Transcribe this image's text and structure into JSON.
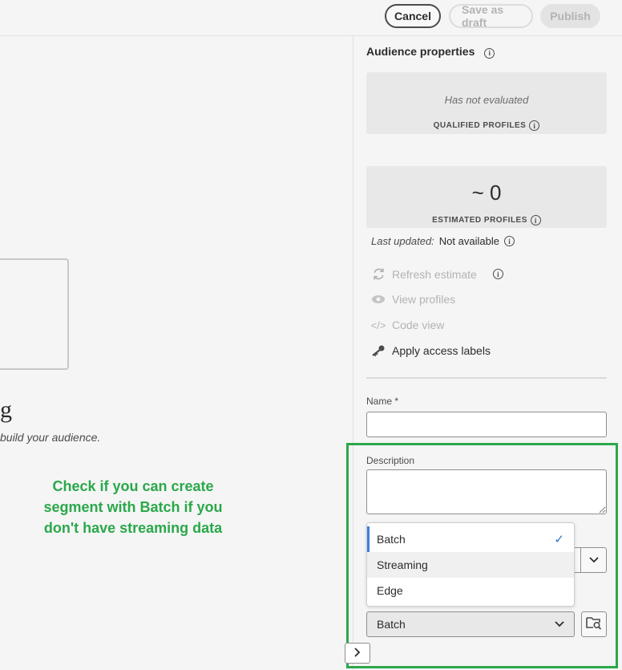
{
  "toolbar": {
    "cancel_label": "Cancel",
    "save_draft_label": "Save as draft",
    "publish_label": "Publish"
  },
  "canvas": {
    "heading_fragment": "g",
    "hint_text": "build your audience."
  },
  "annotation": {
    "text_line1": "Check if you can create",
    "text_line2": "segment with Batch if you",
    "text_line3": "don't have streaming data",
    "color": "#2aa84a"
  },
  "properties": {
    "title": "Audience properties",
    "qualified": {
      "status": "Has not evaluated",
      "label": "QUALIFIED PROFILES"
    },
    "estimated": {
      "value": "~ 0",
      "label": "ESTIMATED PROFILES"
    },
    "last_updated": {
      "label": "Last updated:",
      "value": "Not available"
    },
    "actions": {
      "refresh": "Refresh estimate",
      "view_profiles": "View profiles",
      "code_view": "Code view",
      "apply_labels": "Apply access labels"
    }
  },
  "form": {
    "name_label": "Name",
    "required_mark": "*",
    "name_value": "",
    "description_label": "Description",
    "description_value": ""
  },
  "evaluation_menu": {
    "options": [
      "Batch",
      "Streaming",
      "Edge"
    ],
    "selected": "Batch"
  },
  "merge_select": {
    "value": "Batch"
  },
  "icons": {
    "info": "info-icon",
    "refresh": "refresh-icon",
    "eye": "eye-icon",
    "code": "code-icon",
    "key": "key-icon",
    "check": "checkmark-icon",
    "chevron": "chevron-down-icon",
    "browse": "folder-search-icon",
    "expand": "chevron-right-icon"
  },
  "colors": {
    "accent_blue": "#3d7be0",
    "annotation_green": "#2aa84a"
  }
}
